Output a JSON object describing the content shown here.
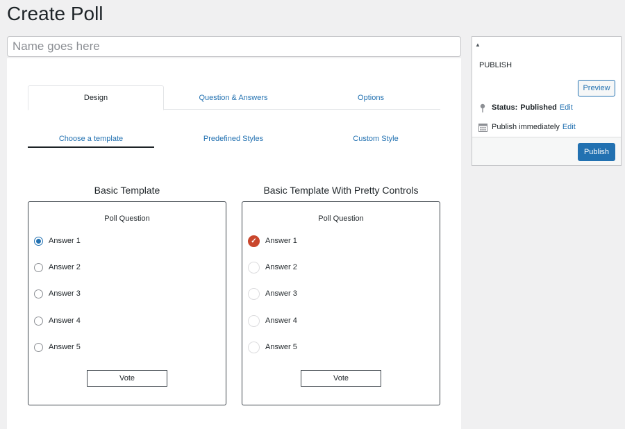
{
  "page": {
    "title": "Create Poll"
  },
  "name_input": {
    "placeholder": "Name goes here",
    "value": ""
  },
  "tabs": [
    {
      "label": "Design",
      "active": true
    },
    {
      "label": "Question & Answers",
      "active": false
    },
    {
      "label": "Options",
      "active": false
    }
  ],
  "subtabs": [
    {
      "label": "Choose a template",
      "active": true
    },
    {
      "label": "Predefined Styles",
      "active": false
    },
    {
      "label": "Custom Style",
      "active": false
    }
  ],
  "templates": [
    {
      "title": "Basic Template",
      "question": "Poll Question",
      "answers": [
        "Answer 1",
        "Answer 2",
        "Answer 3",
        "Answer 4",
        "Answer 5"
      ],
      "selected_index": 0,
      "control_style": "radio",
      "vote_label": "Vote"
    },
    {
      "title": "Basic Template With Pretty Controls",
      "question": "Poll Question",
      "answers": [
        "Answer 1",
        "Answer 2",
        "Answer 3",
        "Answer 4",
        "Answer 5"
      ],
      "selected_index": 0,
      "control_style": "pretty",
      "vote_label": "Vote"
    }
  ],
  "publish_box": {
    "toggle_icon": "triangle-up-icon",
    "heading": "PUBLISH",
    "preview_label": "Preview",
    "status_label": "Status:",
    "status_value": "Published",
    "status_edit": "Edit",
    "schedule_text": "Publish immediately",
    "schedule_edit": "Edit",
    "publish_label": "Publish"
  },
  "colors": {
    "accent": "#2271b1",
    "pretty_checked": "#c9462c",
    "background": "#f0f0f1"
  }
}
